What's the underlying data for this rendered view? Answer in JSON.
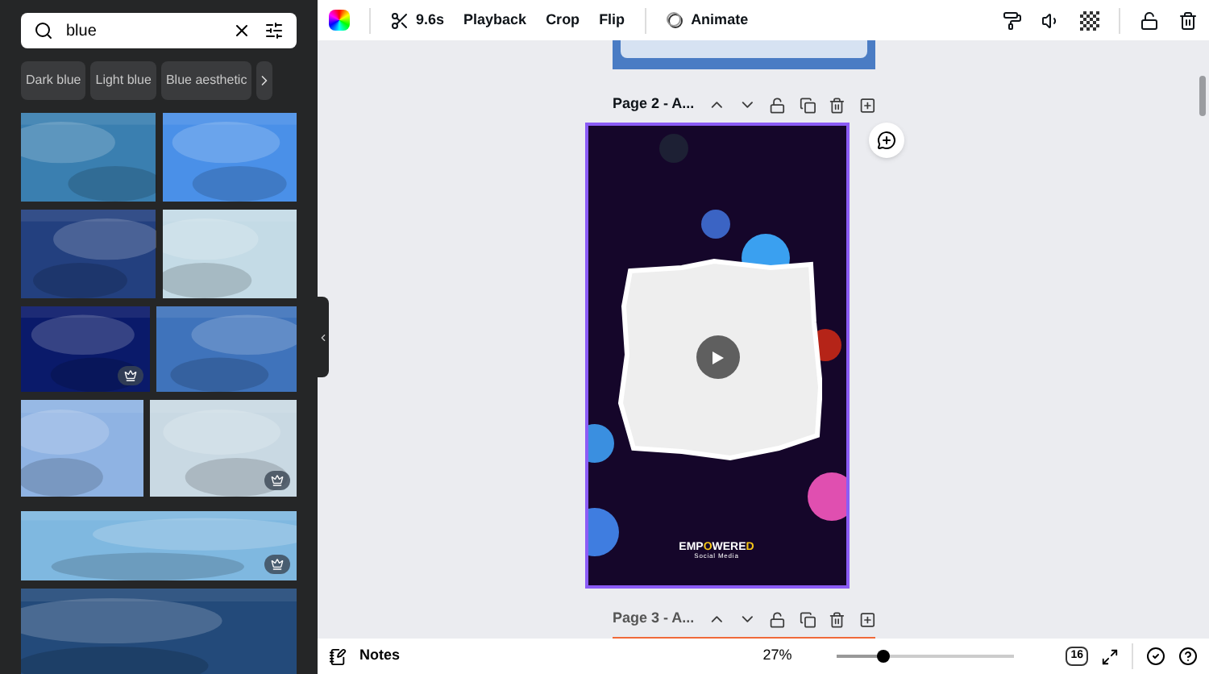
{
  "search": {
    "value": "blue"
  },
  "chips": [
    "Dark blue",
    "Light blue",
    "Blue aesthetic"
  ],
  "images": [
    {
      "premium": false
    },
    {
      "premium": false
    },
    {
      "premium": false
    },
    {
      "premium": false
    },
    {
      "premium": true
    },
    {
      "premium": false
    },
    {
      "premium": false
    },
    {
      "premium": true
    },
    {
      "premium": true
    },
    {
      "premium": false
    }
  ],
  "toolbar": {
    "duration": "9.6s",
    "buttons": [
      "Playback",
      "Crop",
      "Flip"
    ],
    "animate": "Animate"
  },
  "pages": [
    {
      "label": "Page 2 - A...",
      "selected": true
    },
    {
      "label": "Page 3 - A...",
      "selected": false
    }
  ],
  "design": {
    "brand": [
      {
        "text": "EMP",
        "accent": false
      },
      {
        "text": "O",
        "accent": true
      },
      {
        "text": "WERE",
        "accent": false
      },
      {
        "text": "D",
        "accent": true
      }
    ],
    "tagline": "Social Media"
  },
  "footer": {
    "notes": "Notes",
    "zoom": "27%",
    "level": 0.26,
    "page_count": "16"
  }
}
